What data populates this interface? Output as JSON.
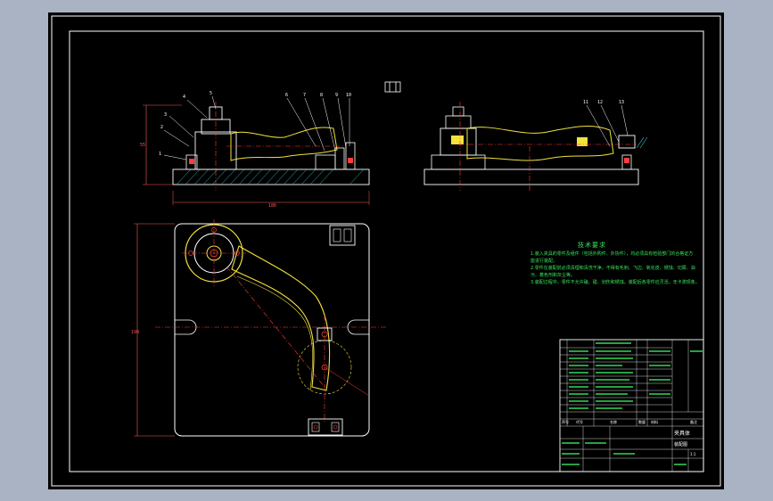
{
  "drawing": {
    "top_mark": "",
    "balloons": [
      "1",
      "2",
      "3",
      "4",
      "5",
      "6",
      "7",
      "8",
      "9",
      "10",
      "11",
      "12",
      "13"
    ],
    "dimensions": {
      "height": "55",
      "length": "186",
      "plan_height": "190"
    }
  },
  "tech_requirements": {
    "title": "技术要求",
    "lines": [
      "1.装入夹具的零件及组件（包括外购件、外协件），均必须具有检验部门的合格证方",
      "  能进行装配。",
      "2.零件在装配前必须清理和清洗干净，不得有毛刺、飞边、氧化皮、锈蚀、切屑、油",
      "  污、着色剂和灰尘等。",
      "3.装配过程中，零件不允许磕、碰、划伤和锈蚀。装配后各零件应灵活，无卡滞现象。"
    ]
  },
  "title_block": {
    "drawing_name": "夹具体",
    "drawing_sub": "装配图",
    "header_cells": [
      "序号",
      "代号",
      "名称",
      "数量",
      "材料",
      "备注"
    ],
    "scale": "1:1"
  },
  "colors": {
    "background": "#000000",
    "frame": "#ffffff",
    "part_outline": "#ffffff",
    "workpiece": "#f2e23c",
    "centerline": "#ff3b3b",
    "dimension": "#ff5a5a",
    "text": "#38e65c",
    "hatch": "#3cc6c6"
  }
}
